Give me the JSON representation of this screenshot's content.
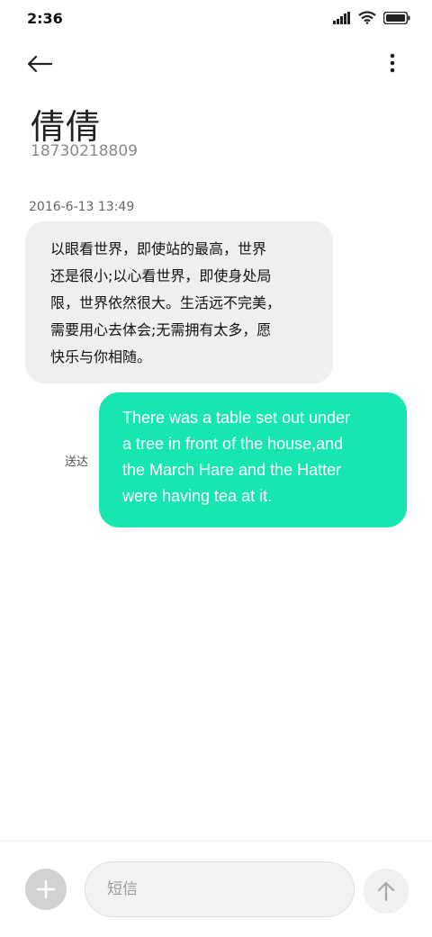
{
  "status_bar": {
    "time": "2:36",
    "icons": [
      "signal-icon",
      "wifi-icon",
      "battery-icon"
    ]
  },
  "top_bar": {
    "back_icon": "arrow-left-icon",
    "more_icon": "more-vertical-icon"
  },
  "contact": {
    "name": "倩倩",
    "number": "18730218809"
  },
  "conversation": {
    "timestamp": "2016-6-13 13:49",
    "incoming": {
      "lines": [
        "以眼看世界，即使站的最高，世界",
        "还是很小;以心看世界，即使身处局",
        "限，世界依然很大。生活远不完美，",
        "需要用心去体会;无需拥有太多，愿",
        "快乐与你相随。"
      ]
    },
    "outgoing": {
      "lines": [
        "There was a table set out under",
        "a tree in front of the house,and",
        "the March Hare and the Hatter",
        "were having tea at it."
      ],
      "status": "送达"
    }
  },
  "composer": {
    "placeholder": "短信",
    "add_icon": "plus-icon",
    "send_icon": "arrow-up-icon"
  },
  "colors": {
    "outgoing_bubble": "#17e6b0",
    "incoming_bubble": "#efefef"
  }
}
